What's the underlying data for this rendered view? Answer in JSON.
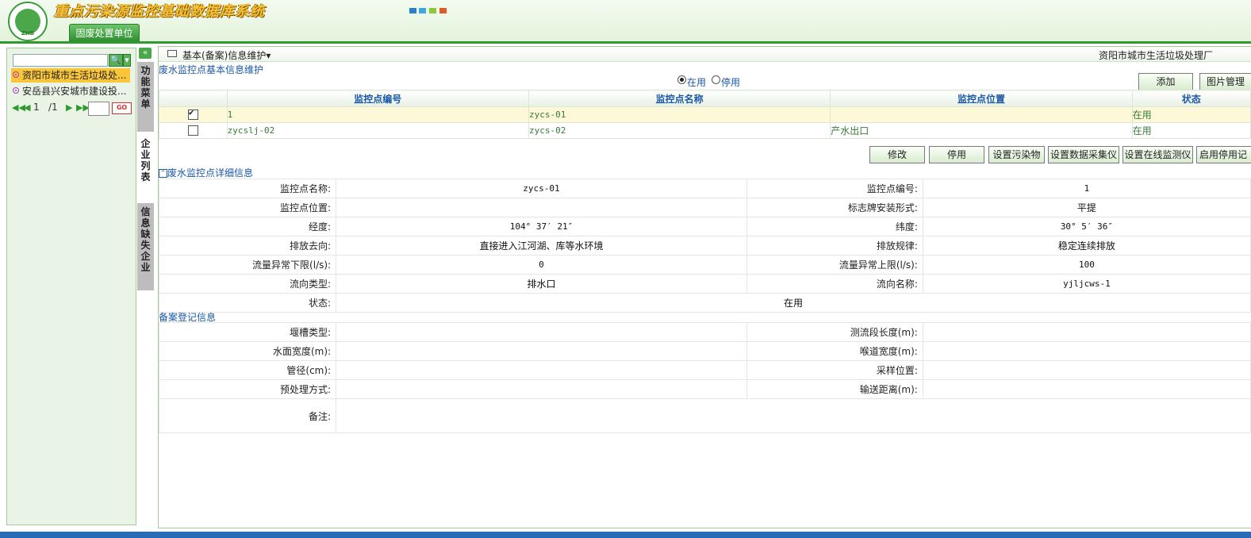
{
  "header": {
    "system_title": "重点污染源监控基础数据库系统",
    "logo_text": "ZHB",
    "nav_tab": "固废处置单位"
  },
  "left": {
    "enterprises": [
      "资阳市城市生活垃圾处...",
      "安岳县兴安城市建设投..."
    ],
    "pager": {
      "current": "1",
      "total": "/1",
      "go": "GO"
    },
    "side_tabs": [
      "功能菜单",
      "企业列表",
      "信息缺失企业"
    ]
  },
  "main": {
    "header_title": "基本(备案)信息维护▾",
    "enterprise_name": "资阳市城市生活垃圾处理厂",
    "section_basic": "废水监控点基本信息维护",
    "radio_active": "在用",
    "radio_inactive": "停用",
    "btn_add": "添加",
    "btn_pic": "图片管理",
    "columns": [
      "监控点编号",
      "监控点名称",
      "监控点位置",
      "状态"
    ],
    "rows": [
      {
        "code": "1",
        "name": "zycs-01",
        "location": "",
        "status": "在用"
      },
      {
        "code": "zycslj-02",
        "name": "zycs-02",
        "location": "产水出口",
        "status": "在用"
      }
    ],
    "actions": [
      "修改",
      "停用",
      "设置污染物",
      "设置数据采集仪",
      "设置在线监测仪",
      "启用停用记"
    ],
    "section_detail": "废水监控点详细信息",
    "detail": {
      "l1": "监控点名称:",
      "v1": "zycs-01",
      "l2": "监控点编号:",
      "v2": "1",
      "l3": "监控点位置:",
      "v3": "",
      "l4": "标志牌安装形式:",
      "v4": "平提",
      "l5": "经度:",
      "v5": "104° 37′ 21″",
      "l6": "纬度:",
      "v6": "30° 5′ 36″",
      "l7": "排放去向:",
      "v7": "直接进入江河湖、库等水环境",
      "l8": "排放规律:",
      "v8": "稳定连续排放",
      "l9": "流量异常下限(l/s):",
      "v9": "0",
      "l10": "流量异常上限(l/s):",
      "v10": "100",
      "l11": "流向类型:",
      "v11": "排水口",
      "l12": "流向名称:",
      "v12": "yjljcws-1",
      "l13": "状态:",
      "v13": "在用"
    },
    "section_record": "备案登记信息",
    "record": {
      "l1": "堰槽类型:",
      "l2": "测流段长度(m):",
      "l3": "水面宽度(m):",
      "l4": "喉道宽度(m):",
      "l5": "管径(cm):",
      "l6": "采样位置:",
      "l7": "预处理方式:",
      "l8": "输送距离(m):",
      "l9": "备注:"
    }
  }
}
